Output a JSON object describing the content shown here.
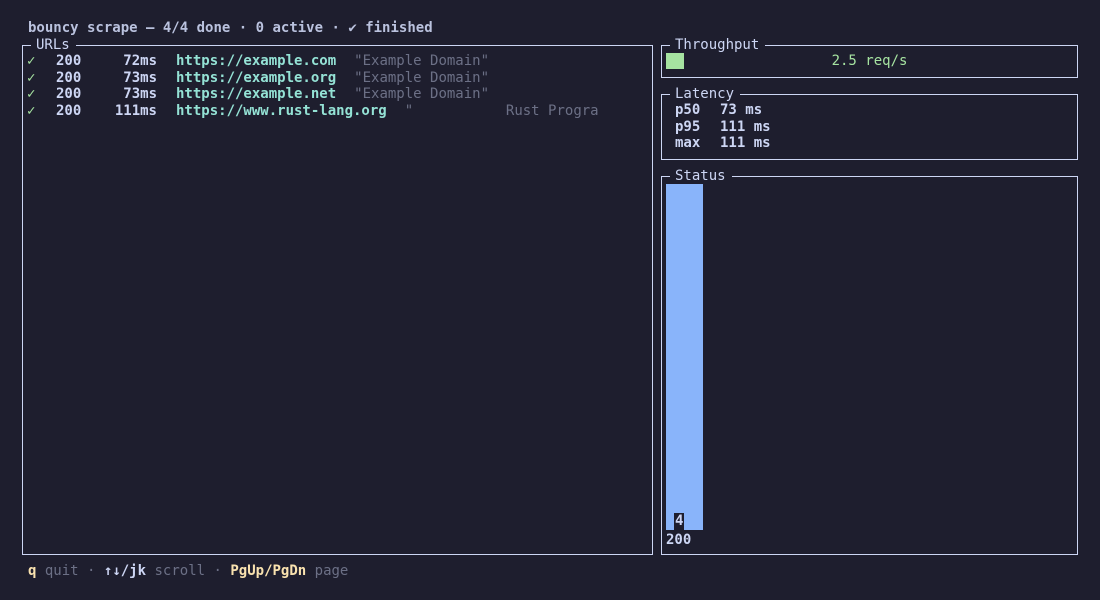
{
  "header": {
    "app": "bouncy scrape",
    "sep": " — ",
    "progress": "4/4 done",
    "dot1": " · ",
    "active": "0 active",
    "dot2": " · ",
    "state": "✔ finished"
  },
  "urls_panel": {
    "title": "URLs",
    "rows": [
      {
        "check": "✓",
        "code": "200",
        "ms": "72ms",
        "url": "https://example.com",
        "title": "\"Example Domain\""
      },
      {
        "check": "✓",
        "code": "200",
        "ms": "73ms",
        "url": "https://example.org",
        "title": "\"Example Domain\""
      },
      {
        "check": "✓",
        "code": "200",
        "ms": "73ms",
        "url": "https://example.net",
        "title": "\"Example Domain\""
      },
      {
        "check": "✓",
        "code": "200",
        "ms": "111ms",
        "url": "https://www.rust-lang.org",
        "title": "\"           Rust Progra"
      }
    ]
  },
  "throughput": {
    "title": "Throughput",
    "value": "2.5 req/s"
  },
  "latency": {
    "title": "Latency",
    "rows": [
      {
        "key": "p50",
        "value": "73 ms"
      },
      {
        "key": "p95",
        "value": "111 ms"
      },
      {
        "key": "max",
        "value": "111 ms"
      }
    ]
  },
  "status": {
    "title": "Status"
  },
  "chart_data": {
    "type": "bar",
    "title": "Status",
    "categories": [
      "200"
    ],
    "values": [
      4
    ],
    "ylim": [
      0,
      4
    ]
  },
  "footer": {
    "quit_key": "q",
    "quit_label": " quit",
    "sep1": " · ",
    "scroll_key": "↑↓/jk",
    "scroll_label": " scroll",
    "sep2": " · ",
    "page_key": "PgUp/PgDn",
    "page_label": " page"
  },
  "colors": {
    "background": "#1e1e2e",
    "ok": "#a6e3a1",
    "url": "#94e2d5",
    "muted": "#6c7086",
    "bar": "#89b4fa",
    "key": "#f9e2af"
  }
}
